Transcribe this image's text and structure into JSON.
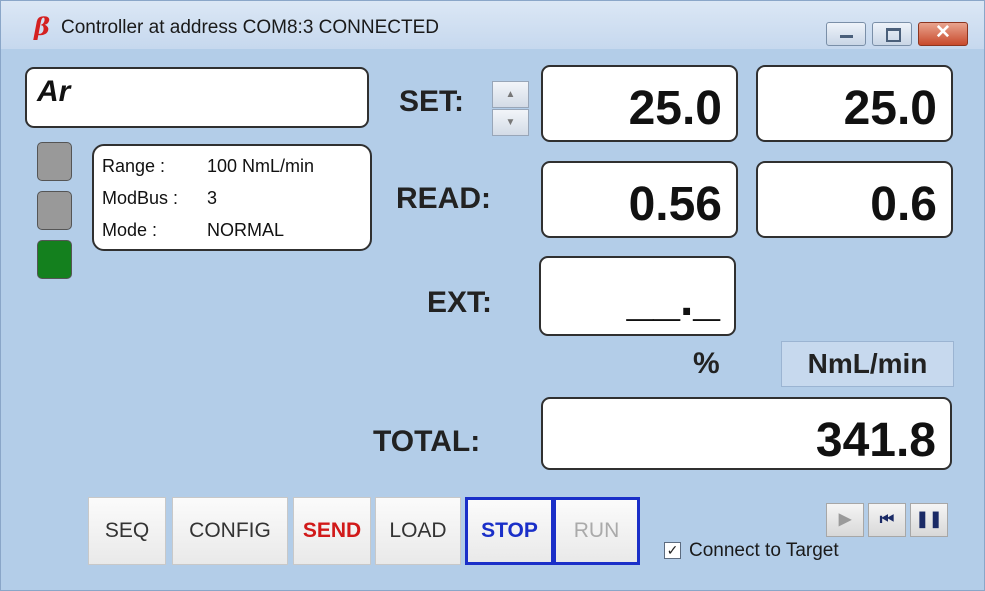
{
  "window": {
    "app_icon": "β",
    "title": "Controller at address COM8:3 CONNECTED",
    "minimize_icon": "minimize-icon",
    "maximize_icon": "maximize-icon",
    "close_glyph": "✕"
  },
  "gas": {
    "name": "Ar"
  },
  "leds": [
    {
      "state": "off",
      "color": "#999999"
    },
    {
      "state": "off",
      "color": "#999999"
    },
    {
      "state": "on",
      "color": "#14801e"
    }
  ],
  "info": {
    "range_label": "Range :",
    "range_value": "100 NmL/min",
    "modbus_label": "ModBus :",
    "modbus_value": "3",
    "mode_label": "Mode :",
    "mode_value": "NORMAL"
  },
  "labels": {
    "set": "SET:",
    "read": "READ:",
    "ext": "EXT:",
    "total": "TOTAL:"
  },
  "spinner": {
    "up": "▲",
    "down": "▼"
  },
  "values": {
    "set_percent": "25.0",
    "set_flow": "25.0",
    "read_percent": "0.56",
    "read_flow": "0.6",
    "ext_percent": "__._",
    "total": "341.8"
  },
  "units": {
    "percent": "%",
    "flow": "NmL/min"
  },
  "buttons": {
    "seq": "SEQ",
    "config": "CONFIG",
    "send": "SEND",
    "load": "LOAD",
    "stop": "STOP",
    "run": "RUN"
  },
  "connect": {
    "checked": true,
    "check_glyph": "✓",
    "label": "Connect to Target"
  },
  "transport": {
    "play": "▶",
    "first": "⏮",
    "pause": "❚❚"
  },
  "colors": {
    "accent_blue": "#1a2fc8",
    "send_red": "#d11a1a",
    "background": "#b3cde8"
  }
}
